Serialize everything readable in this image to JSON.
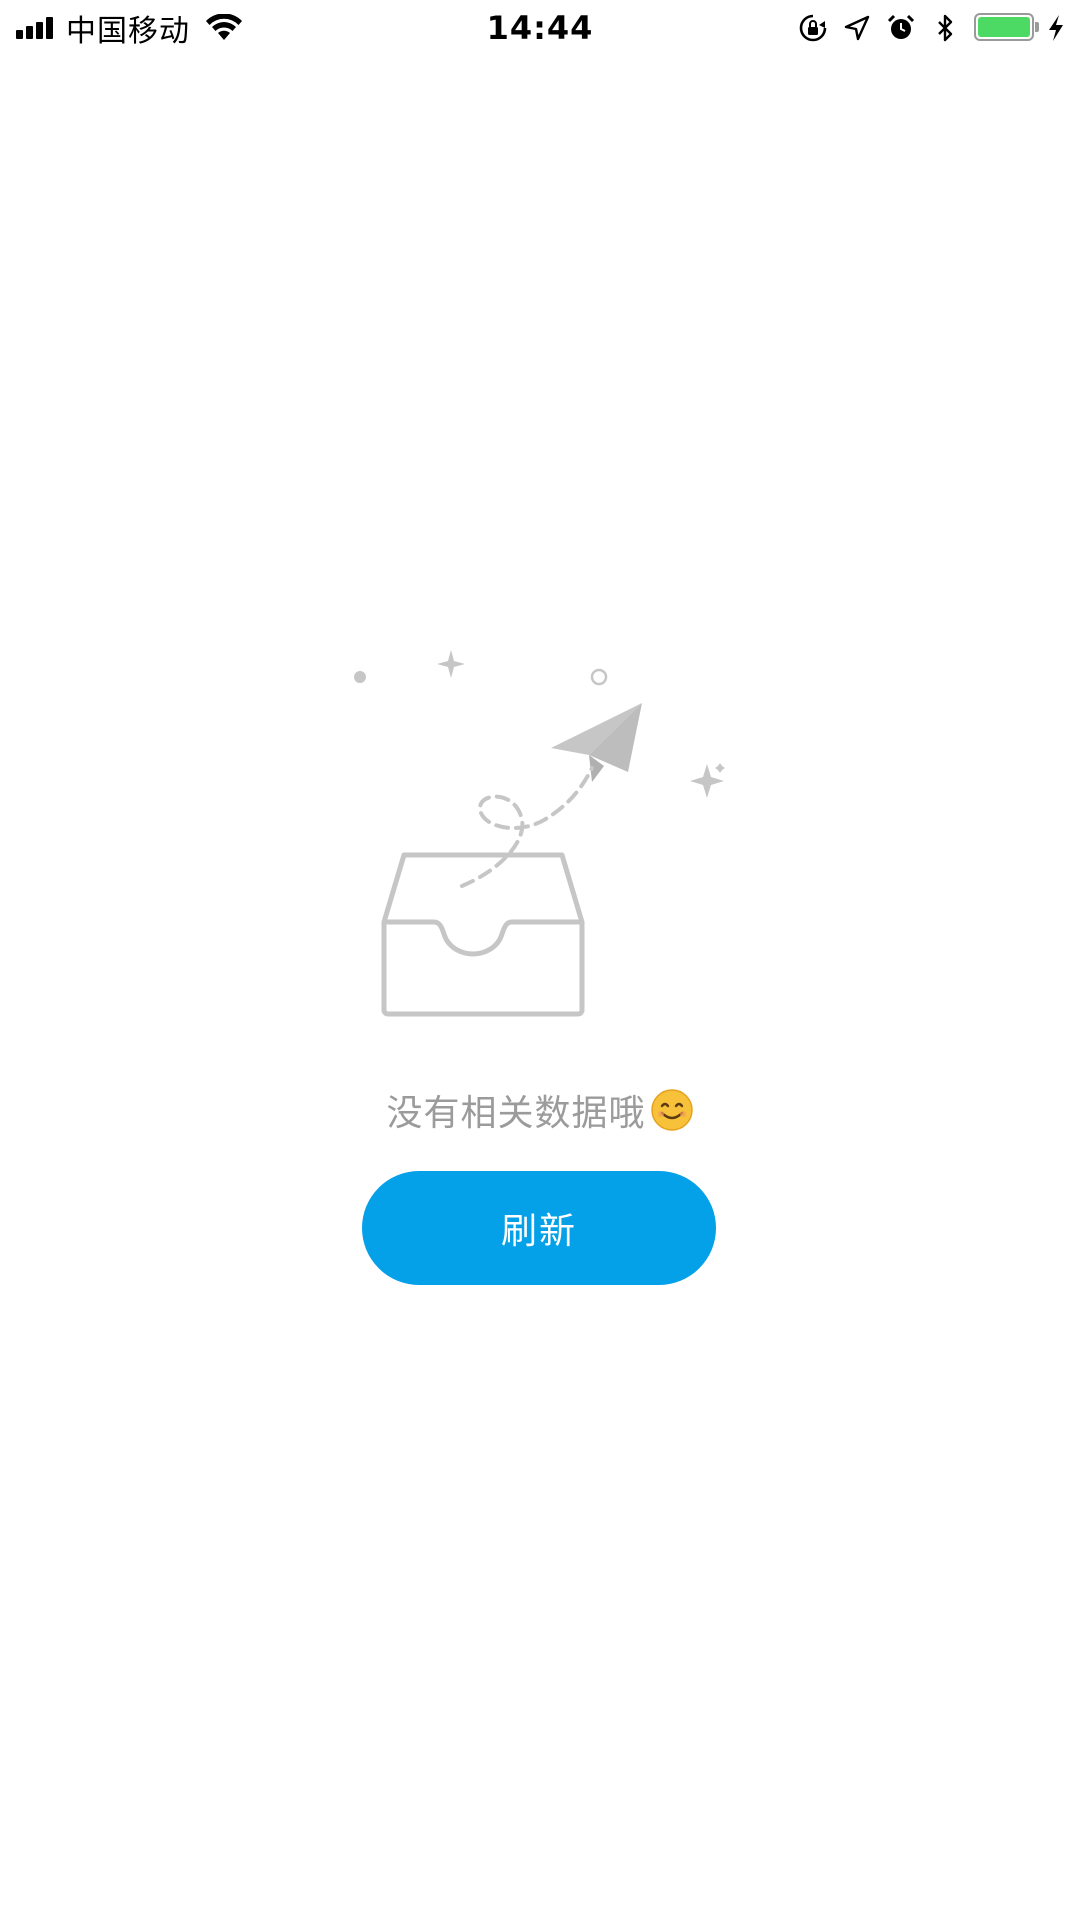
{
  "status_bar": {
    "carrier": "中国移动",
    "time": "14:44",
    "icons": [
      "signal-icon",
      "wifi-icon",
      "rotation-lock-icon",
      "location-icon",
      "alarm-icon",
      "bluetooth-icon",
      "battery-icon",
      "charging-icon"
    ],
    "battery_color": "#4cd964"
  },
  "empty_state": {
    "illustration": "empty-inbox-paper-plane-icon",
    "message": "没有相关数据哦",
    "emoji_icon": "smiling-face-icon"
  },
  "refresh_button": {
    "label": "刷新",
    "color": "#04a0e8"
  }
}
